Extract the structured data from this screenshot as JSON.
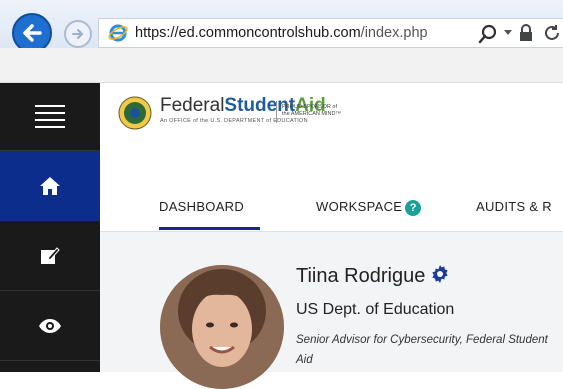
{
  "browser": {
    "url_host": "https://ed.commoncontrolshub.com",
    "url_path": "/index.php"
  },
  "header": {
    "brand_regular": "Federal",
    "brand_bold": "Student",
    "brand_aid": "Aid",
    "brand_sub": "An OFFICE of the U.S. DEPARTMENT of EDUCATION",
    "sponsor_line1": "PROUD SPONSOR of",
    "sponsor_line2": "the AMERICAN MIND™"
  },
  "nav": {
    "tabs": [
      {
        "label": "DASHBOARD",
        "active": true
      },
      {
        "label": "WORKSPACE",
        "badge": "?"
      },
      {
        "label": "AUDITS & R"
      }
    ]
  },
  "sidebar": {
    "items": [
      "menu-icon",
      "home-icon",
      "edit-icon",
      "eye-icon"
    ]
  },
  "profile": {
    "name": "Tiina Rodrigue",
    "org": "US Dept. of Education",
    "title": "Senior Advisor for Cybersecurity, Federal Student Aid"
  },
  "colors": {
    "sidebar_bg": "#1a1a1a",
    "sidebar_active": "#0d2d8c",
    "accent": "#0d2d8c",
    "badge": "#1ba19a",
    "gear": "#1b3a9e"
  }
}
